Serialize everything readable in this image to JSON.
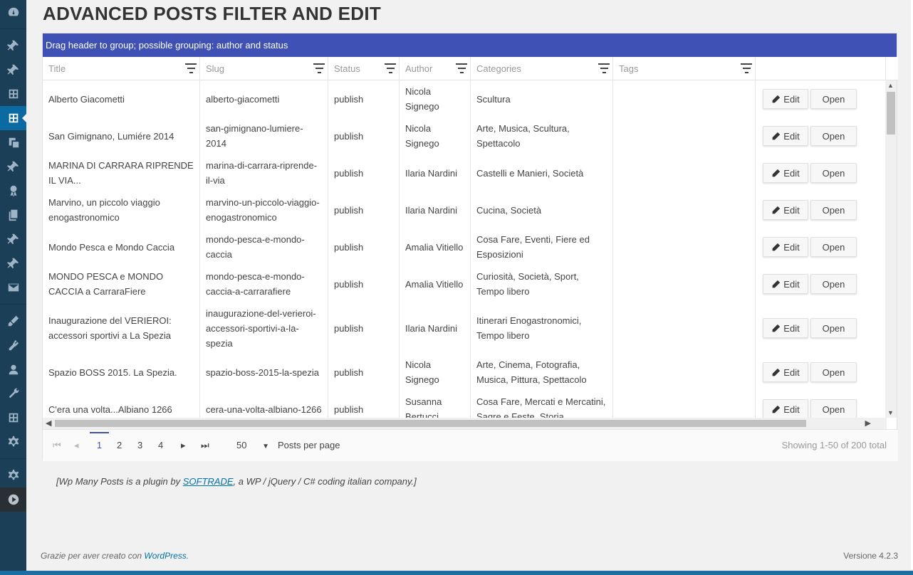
{
  "sidebar": {
    "icons": [
      "dashboard-icon",
      "pin-icon",
      "pin-icon",
      "grid-plugin-icon",
      "grid-plugin-icon",
      "media-icon",
      "pin-icon",
      "award-icon",
      "pages-icon",
      "pin-icon",
      "pin-icon",
      "mail-icon",
      "appearance-icon",
      "plugins-icon",
      "users-icon",
      "tools-icon",
      "grid-plugin-icon",
      "settings-icon",
      "settings-icon",
      "play-icon"
    ]
  },
  "page": {
    "title": "ADVANCED POSTS FILTER AND EDIT"
  },
  "grid": {
    "group_bar": "Drag header to group; possible grouping: author and status",
    "columns": [
      "Title",
      "Slug",
      "Status",
      "Author",
      "Categories",
      "Tags"
    ],
    "edit_label": "Edit",
    "open_label": "Open",
    "rows": [
      {
        "title": "Alberto Giacometti",
        "slug": "alberto-giacometti",
        "status": "publish",
        "author": "Nicola Signego",
        "categories": "Scultura",
        "tags": ""
      },
      {
        "title": "San Gimignano, Lumiére 2014",
        "slug": "san-gimignano-lumiere-2014",
        "status": "publish",
        "author": "Nicola Signego",
        "categories": "Arte, Musica, Scultura, Spettacolo",
        "tags": ""
      },
      {
        "title": "MARINA DI CARRARA RIPRENDE IL VIA...",
        "slug": "marina-di-carrara-riprende-il-via",
        "status": "publish",
        "author": "Ilaria Nardini",
        "categories": "Castelli e Manieri, Società",
        "tags": ""
      },
      {
        "title": "Marvino, un piccolo viaggio enogastronomico",
        "slug": "marvino-un-piccolo-viaggio-enogastronomico",
        "status": "publish",
        "author": "Ilaria Nardini",
        "categories": "Cucina, Società",
        "tags": ""
      },
      {
        "title": "Mondo Pesca e Mondo Caccia",
        "slug": "mondo-pesca-e-mondo-caccia",
        "status": "publish",
        "author": "Amalia Vitiello",
        "categories": "Cosa Fare, Eventi, Fiere ed Esposizioni",
        "tags": ""
      },
      {
        "title": "MONDO PESCA e MONDO CACCIA a CarraraFiere",
        "slug": "mondo-pesca-e-mondo-caccia-a-carrarafiere",
        "status": "publish",
        "author": "Amalia Vitiello",
        "categories": "Curiosità, Società, Sport, Tempo libero",
        "tags": ""
      },
      {
        "title": "Inaugurazione del VERIEROI: accessori sportivi a La Spezia",
        "slug": "inaugurazione-del-verieroi-accessori-sportivi-a-la-spezia",
        "status": "publish",
        "author": "Ilaria Nardini",
        "categories": "Itinerari Enogastronomici, Tempo libero",
        "tags": ""
      },
      {
        "title": "Spazio BOSS 2015. La Spezia.",
        "slug": "spazio-boss-2015-la-spezia",
        "status": "publish",
        "author": "Nicola Signego",
        "categories": "Arte, Cinema, Fotografia, Musica, Pittura, Spettacolo",
        "tags": ""
      },
      {
        "title": "C'era una volta...Albiano 1266",
        "slug": "cera-una-volta-albiano-1266",
        "status": "publish",
        "author": "Susanna Bertucci",
        "categories": "Cosa Fare, Mercati e Mercatini, Sagre e Feste, Storia",
        "tags": ""
      }
    ]
  },
  "pager": {
    "pages": [
      "1",
      "2",
      "3",
      "4"
    ],
    "current": "1",
    "page_size": "50",
    "per_page_label": "Posts per page",
    "info": "Showing 1-50 of 200 total"
  },
  "note": {
    "before": "[Wp Many Posts is a plugin by ",
    "link": "SOFTRADE",
    "after": ", a WP / jQuery / C# coding italian company.]"
  },
  "footer": {
    "text": "Grazie per aver creato con ",
    "link": "WordPress.",
    "version": "Versione 4.2.3"
  },
  "colors": {
    "accent": "#3f51b5",
    "sidebar": "#1b3f57",
    "sidebar_active": "#0b6aa2",
    "link": "#0073aa"
  }
}
